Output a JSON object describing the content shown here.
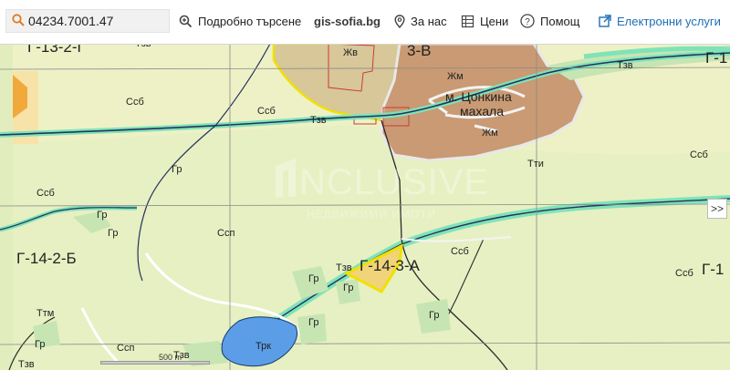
{
  "toolbar": {
    "search_value": "04234.7001.47",
    "advanced_search": "Подробно търсене",
    "brand": "gis-sofia.bg",
    "about": "За нас",
    "prices": "Цени",
    "help": "Помощ",
    "eservices": "Електронни услуги"
  },
  "map": {
    "labels": {
      "ssb": "Ссб",
      "tzv": "Тзв",
      "gr": "Гр",
      "ssp": "Ссп",
      "zhv": "Жв",
      "zhm": "Жм",
      "tti": "Тти",
      "trk": "Трк",
      "ttm": "Ттм"
    },
    "sheets": {
      "g132g": "Г-13-2-Г",
      "g132v": "3-В",
      "g131": "Г-1",
      "g142b": "Г-14-2-Б",
      "g143a": "Г-14-3-А",
      "g14": "Г-1"
    },
    "village_name": "м. Цонкина",
    "village_name2": "махала",
    "scale_label": "500 m",
    "expand_label": ">>",
    "watermark_brand": "NCLUSIVE",
    "watermark_sub": "НЕДВИЖИМИ ИМОТИ"
  },
  "colors": {
    "map_background": "#eef1c6",
    "light_field": "#e6f0c2",
    "dry_land": "#d7c799",
    "village": "#c99a73",
    "parcel_highlight": "#f1e000",
    "river": "#26335e",
    "river_buffer": "#7fe3b8",
    "forest": "#c7e5b3",
    "accent_blue": "#1d6fb5"
  }
}
